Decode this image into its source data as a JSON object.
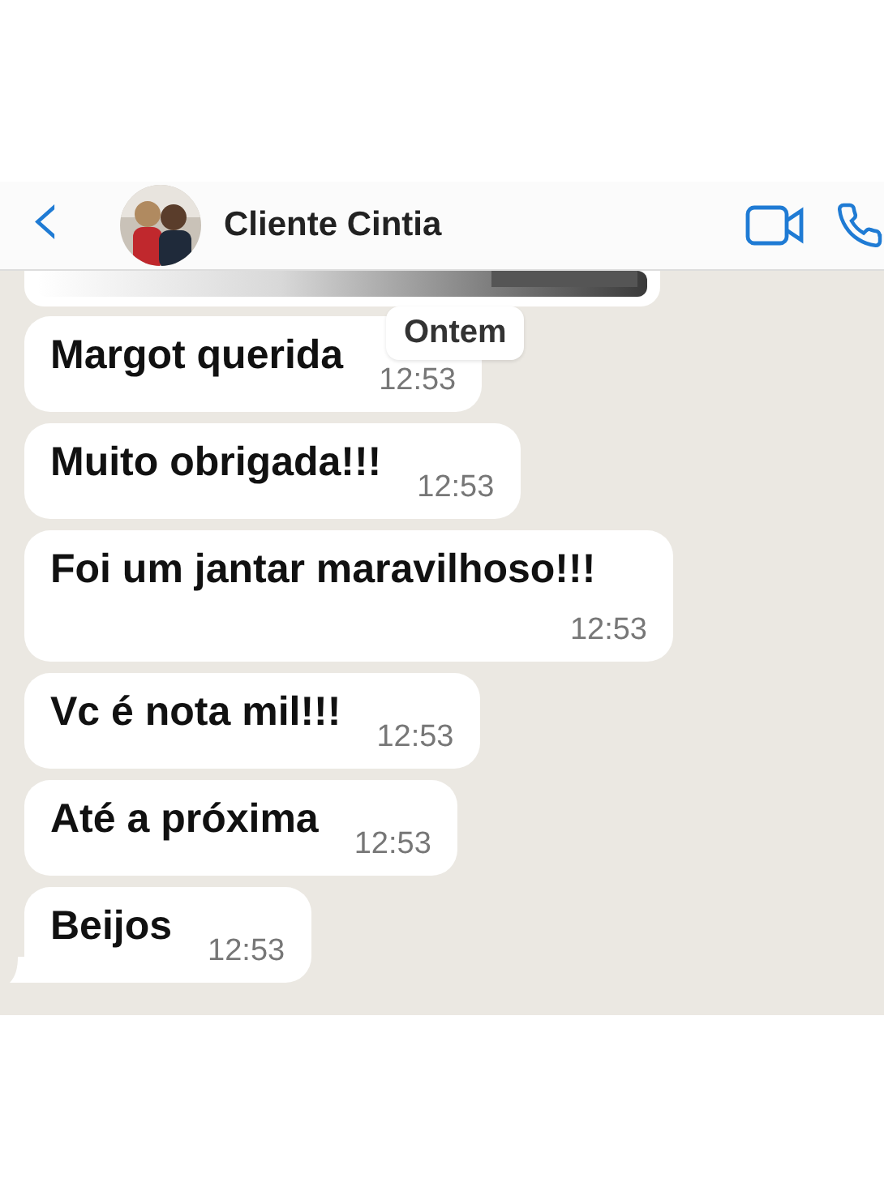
{
  "header": {
    "back": "‹",
    "contact_name": "Cliente Cintia"
  },
  "date_chip": "Ontem",
  "messages": [
    {
      "text": "Margot querida",
      "time": "12:53",
      "tail": false
    },
    {
      "text": "Muito obrigada!!!",
      "time": "12:53",
      "tail": false
    },
    {
      "text": "Foi um jantar maravilhoso!!!",
      "time": "12:53",
      "tail": false
    },
    {
      "text": "Vc é nota mil!!!",
      "time": "12:53",
      "tail": false
    },
    {
      "text": "Até a próxima",
      "time": "12:53",
      "tail": false
    },
    {
      "text": "Beijos",
      "time": "12:53",
      "tail": true
    }
  ]
}
